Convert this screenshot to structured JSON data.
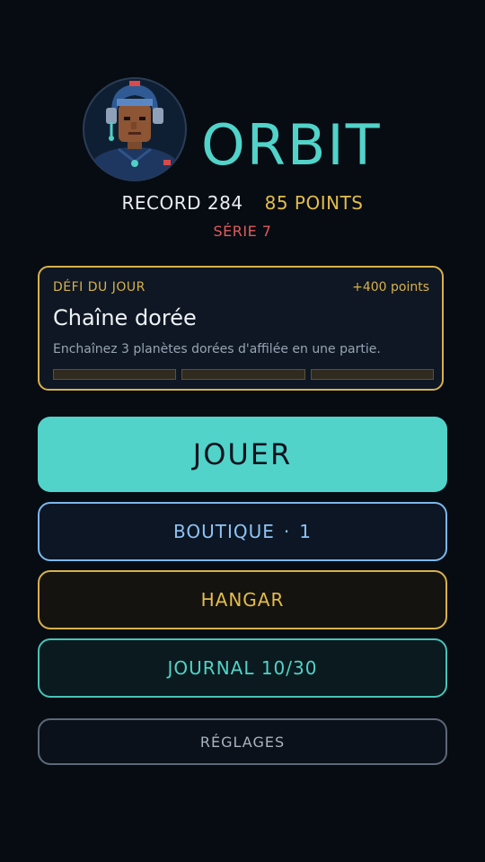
{
  "header": {
    "title": "ORBIT",
    "record": "RECORD 284",
    "points": "85 POINTS",
    "streak": "SÉRIE 7"
  },
  "avatar": {
    "icon": "astronaut-pilot-portrait-icon"
  },
  "daily_challenge": {
    "label": "DÉFI DU JOUR",
    "reward": "+400 points",
    "name": "Chaîne dorée",
    "description": "Enchaînez 3 planètes dorées d'affilée en une partie.",
    "progress": 0,
    "goal": 3
  },
  "menu": {
    "play": "JOUER",
    "shop": "BOUTIQUE",
    "shop_separator": "·",
    "shop_badge": "1",
    "hangar": "HANGAR",
    "journal": "JOURNAL 10/30",
    "settings": "RÉGLAGES"
  },
  "colors": {
    "background": "#070c13",
    "accent_teal": "#51d3c9",
    "gold": "#d8b14c",
    "blue": "#7db7ec",
    "red": "#dd5c5c"
  }
}
